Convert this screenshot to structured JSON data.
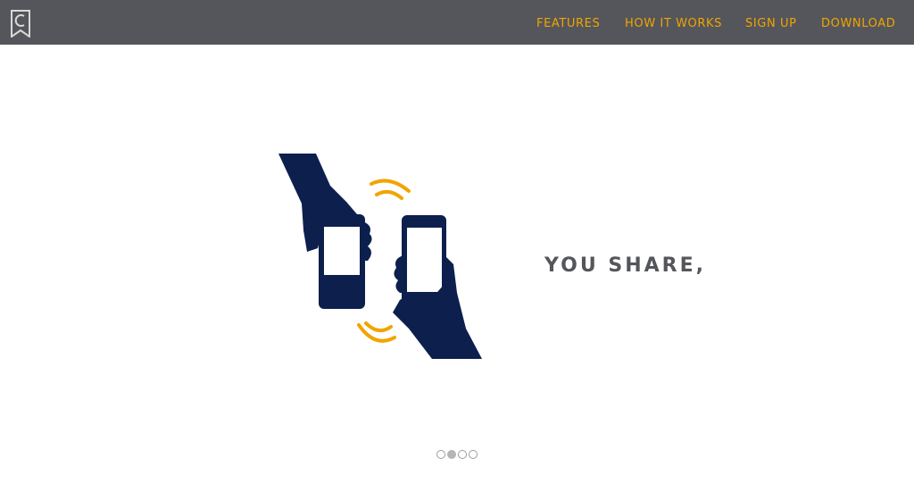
{
  "header": {
    "logo_icon": "bookmark-c-logo-icon",
    "nav": [
      {
        "label": "FEATURES"
      },
      {
        "label": "HOW IT WORKS"
      },
      {
        "label": "SIGN UP"
      },
      {
        "label": "DOWNLOAD"
      }
    ],
    "nav_color": "#f0a500",
    "bar_color": "#55565b"
  },
  "hero": {
    "illustration_icon": "hands-sharing-phones-icon",
    "tagline": "YOU SHARE,",
    "navy": "#0d1f4d",
    "signal_color": "#f0a500"
  },
  "carousel": {
    "slide_count": 4,
    "active_index": 1
  }
}
